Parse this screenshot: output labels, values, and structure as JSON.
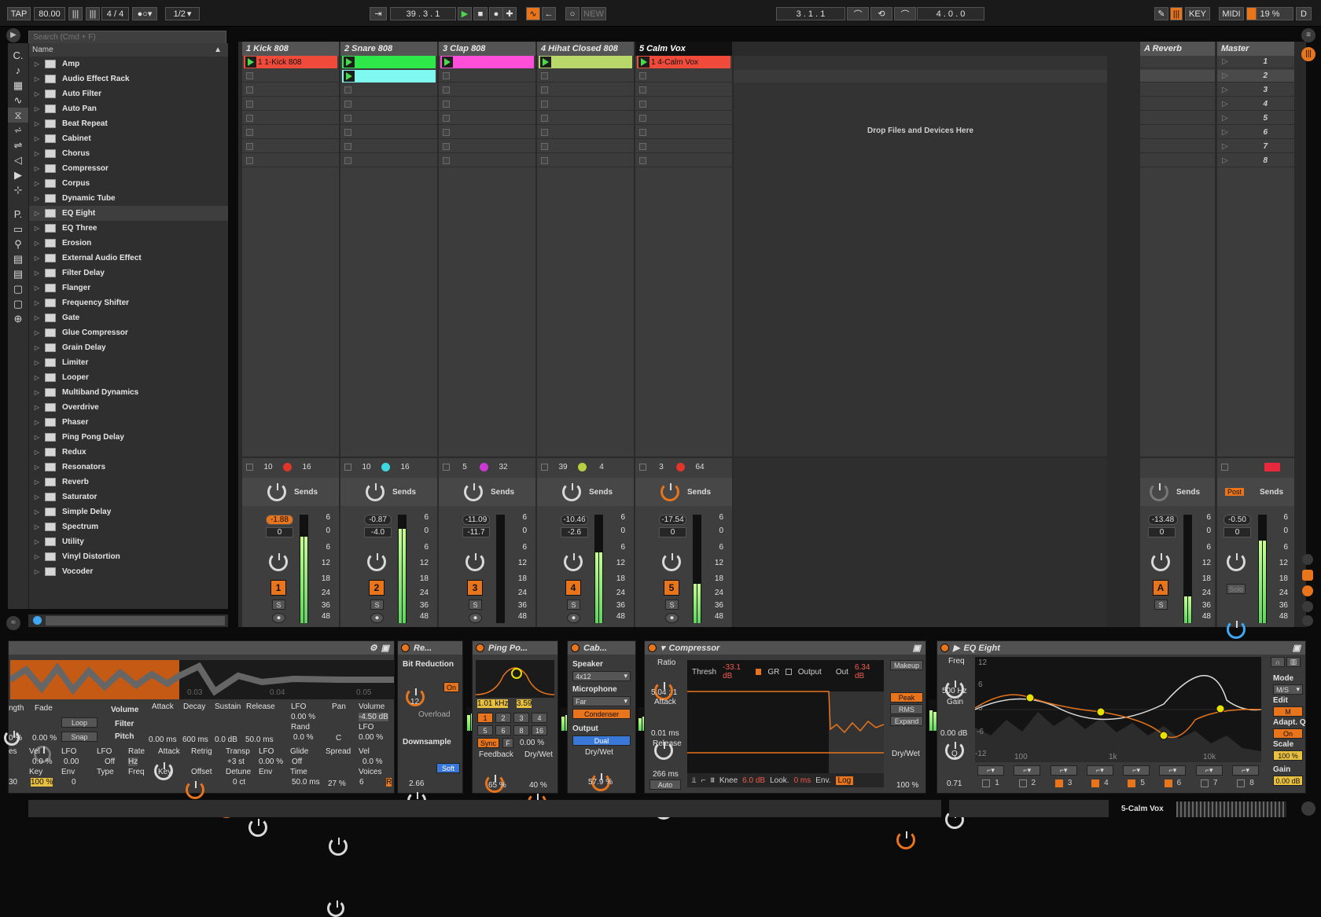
{
  "transport": {
    "tap": "TAP",
    "tempo": "80.00",
    "sig": "4 / 4",
    "quant": "1/2",
    "position": "39 .  3 .  1",
    "loop_start": "3 .  1 .  1",
    "loop_len": "4 .  0 .  0",
    "new_label": "NEW",
    "key": "KEY",
    "midi": "MIDI",
    "cpu": "19 %",
    "d": "D"
  },
  "browser": {
    "search_placeholder": "Search (Cmd + F)",
    "col_c": "C.",
    "col_name": "Name",
    "col_p": "P.",
    "items": [
      "Amp",
      "Audio Effect Rack",
      "Auto Filter",
      "Auto Pan",
      "Beat Repeat",
      "Cabinet",
      "Chorus",
      "Compressor",
      "Corpus",
      "Dynamic Tube",
      "EQ Eight",
      "EQ Three",
      "Erosion",
      "External Audio Effect",
      "Filter Delay",
      "Flanger",
      "Frequency Shifter",
      "Gate",
      "Glue Compressor",
      "Grain Delay",
      "Limiter",
      "Looper",
      "Multiband Dynamics",
      "Overdrive",
      "Phaser",
      "Ping Pong Delay",
      "Redux",
      "Resonators",
      "Reverb",
      "Saturator",
      "Simple Delay",
      "Spectrum",
      "Utility",
      "Vinyl Distortion",
      "Vocoder"
    ]
  },
  "tracks": [
    {
      "name": "1 Kick 808",
      "clip": "1 1-Kick 808",
      "clip_color": "#f04a3a",
      "in": "10",
      "out": "16",
      "vol": "-1.88",
      "pan": "0",
      "num": "1",
      "dot": "#e0352a"
    },
    {
      "name": "2 Snare 808",
      "clip": "",
      "clip_color": "#2ee84a",
      "clip2_color": "#7ff8f0",
      "in": "10",
      "out": "16",
      "vol": "-0.87",
      "pan": "-4.0",
      "num": "2",
      "dot": "#3ed8e0"
    },
    {
      "name": "3 Clap 808",
      "clip": "",
      "clip_color": "#ff4fd8",
      "in": "5",
      "out": "32",
      "vol": "-11.09",
      "pan": "-11.7",
      "num": "3",
      "dot": "#c93ad0"
    },
    {
      "name": "4 Hihat Closed 808",
      "clip": "",
      "clip_color": "#b8d96a",
      "in": "39",
      "out": "4",
      "vol": "-10.46",
      "pan": "-2.6",
      "num": "4",
      "dot": "#b8d040"
    },
    {
      "name": "5 Calm Vox",
      "clip": "1 4-Calm Vox",
      "clip_color": "#f04a3a",
      "in": "3",
      "out": "64",
      "vol": "-17.54",
      "pan": "0",
      "num": "5",
      "dot": "#e0352a"
    }
  ],
  "drop_text": "Drop Files and Devices Here",
  "returns": {
    "name": "A Reverb",
    "vol": "-13.48",
    "pan": "0",
    "num": "A"
  },
  "master": {
    "name": "Master",
    "vol": "-0.50",
    "pan": "0",
    "scenes": [
      "1",
      "2",
      "3",
      "4",
      "5",
      "6",
      "7",
      "8"
    ],
    "post": "Post",
    "solo": "Solo"
  },
  "sends_label": "Sends",
  "db_scale": [
    "6",
    "0",
    "6",
    "12",
    "18",
    "24",
    "36",
    "48"
  ],
  "sampler": {
    "length": "ngth",
    "fade": "Fade",
    "loop": "Loop",
    "snap": "Snap",
    "volume": "Volume",
    "filter": "Filter",
    "pitch": "Pitch",
    "attack": "Attack",
    "decay": "Decay",
    "sustain": "Sustain",
    "release": "Release",
    "lfo": "LFO",
    "pan": "Pan",
    "vol_label": "Volume",
    "a_val": "0.00 ms",
    "d_val": "600 ms",
    "s_val": "0.0 dB",
    "r_val": "50.0 ms",
    "lfo_val": "0.00 %",
    "rand": "Rand",
    "rand_val": "0.0 %",
    "pan_val": "C",
    "vol_val": "-4.50 dB",
    "lfo2_val": "0.00 %",
    "vel": "Vel",
    "vel_val": "0.0 %",
    "key": "Key",
    "key_val": "100 %",
    "lfo3": "LFO",
    "lfo3_val": "0.00",
    "env": "Env",
    "env_val": "0",
    "type": "Type",
    "off": "Off",
    "rate": "Rate",
    "freq": "Freq",
    "retrig": "Retrig",
    "transp": "Transp",
    "transp_val": "+3 st",
    "detune": "Detune",
    "detune_val": "0 ct",
    "lfo4": "LFO",
    "lfo4_val": "0.00 %",
    "glide": "Glide",
    "glide_val": "Off",
    "time": "Time",
    "time_val": "50.0 ms",
    "spread": "Spread",
    "spread_val": "27 %",
    "vel2": "Vel",
    "vel2_val": "0.0 %",
    "voices": "Voices",
    "voices_val": "6",
    "offset": "Offset",
    "hz": "Hz",
    "r": "R",
    "key2": "Key",
    "es": "es",
    "zero30": "30",
    "pct0": "0 %",
    "pct02": "0.00 %",
    "ms30": "0.00",
    "t03": "0.03",
    "t04": "0.04",
    "t05": "0.05"
  },
  "redux": {
    "title": "Re...",
    "bit": "Bit Reduction",
    "bit_val": "12",
    "on": "On",
    "overload": "Overload",
    "down": "Downsample",
    "down_val": "2.66",
    "soft": "Soft"
  },
  "pingpong": {
    "title": "Ping Po...",
    "freq": "1.01 kHz",
    "q": "3.59",
    "b1": "1",
    "b2": "2",
    "b3": "3",
    "b4": "4",
    "b5": "5",
    "b6": "6",
    "b8": "8",
    "b16": "16",
    "sync": "Sync",
    "f": "F",
    "pct": "0.00 %",
    "feedback": "Feedback",
    "fb_val": "65 %",
    "drywet": "Dry/Wet",
    "dw_val": "40 %"
  },
  "cabinet": {
    "title": "Cab...",
    "speaker": "Speaker",
    "speaker_val": "4x12",
    "mic": "Microphone",
    "mic_val": "Far",
    "condenser": "Condenser",
    "output": "Output",
    "dual": "Dual",
    "drywet": "Dry/Wet",
    "dw_val": "57.9 %"
  },
  "compressor": {
    "title": "Compressor",
    "ratio": "Ratio",
    "ratio_val": "5.04 : 1",
    "attack": "Attack",
    "attack_val": "0.01 ms",
    "release": "Release",
    "release_val": "266 ms",
    "auto": "Auto",
    "thresh": "Thresh",
    "thresh_val": "-33.1 dB",
    "gr": "GR",
    "output": "Output",
    "out": "Out",
    "out_val": "6.34 dB",
    "makeup": "Makeup",
    "peak": "Peak",
    "rms": "RMS",
    "expand": "Expand",
    "drywet": "Dry/Wet",
    "dw_val": "100 %",
    "knee": "Knee",
    "knee_val": "6.0 dB",
    "look": "Look.",
    "look_val": "0 ms",
    "env": "Env.",
    "log": "Log"
  },
  "eq": {
    "title": "EQ Eight",
    "freq": "Freq",
    "freq_val": "500 Hz",
    "gain": "Gain",
    "gain_val": "0.00 dB",
    "q": "Q",
    "q_val": "0.71",
    "mode": "Mode",
    "mode_val": "M/S",
    "edit": "Edit",
    "edit_val": "M",
    "adapt": "Adapt. Q",
    "adapt_val": "On",
    "scale": "Scale",
    "scale_val": "100 %",
    "gain2": "Gain",
    "gain2_val": "0.00 dB",
    "bands": [
      "1",
      "2",
      "3",
      "4",
      "5",
      "6",
      "7",
      "8"
    ],
    "axis_top": "12",
    "axis_6": "6",
    "axis_0": "0",
    "axis_m6": "-6",
    "axis_m12": "-12",
    "f100": "100",
    "f1k": "1k",
    "f10k": "10k"
  },
  "status": {
    "track": "5-Calm Vox"
  }
}
